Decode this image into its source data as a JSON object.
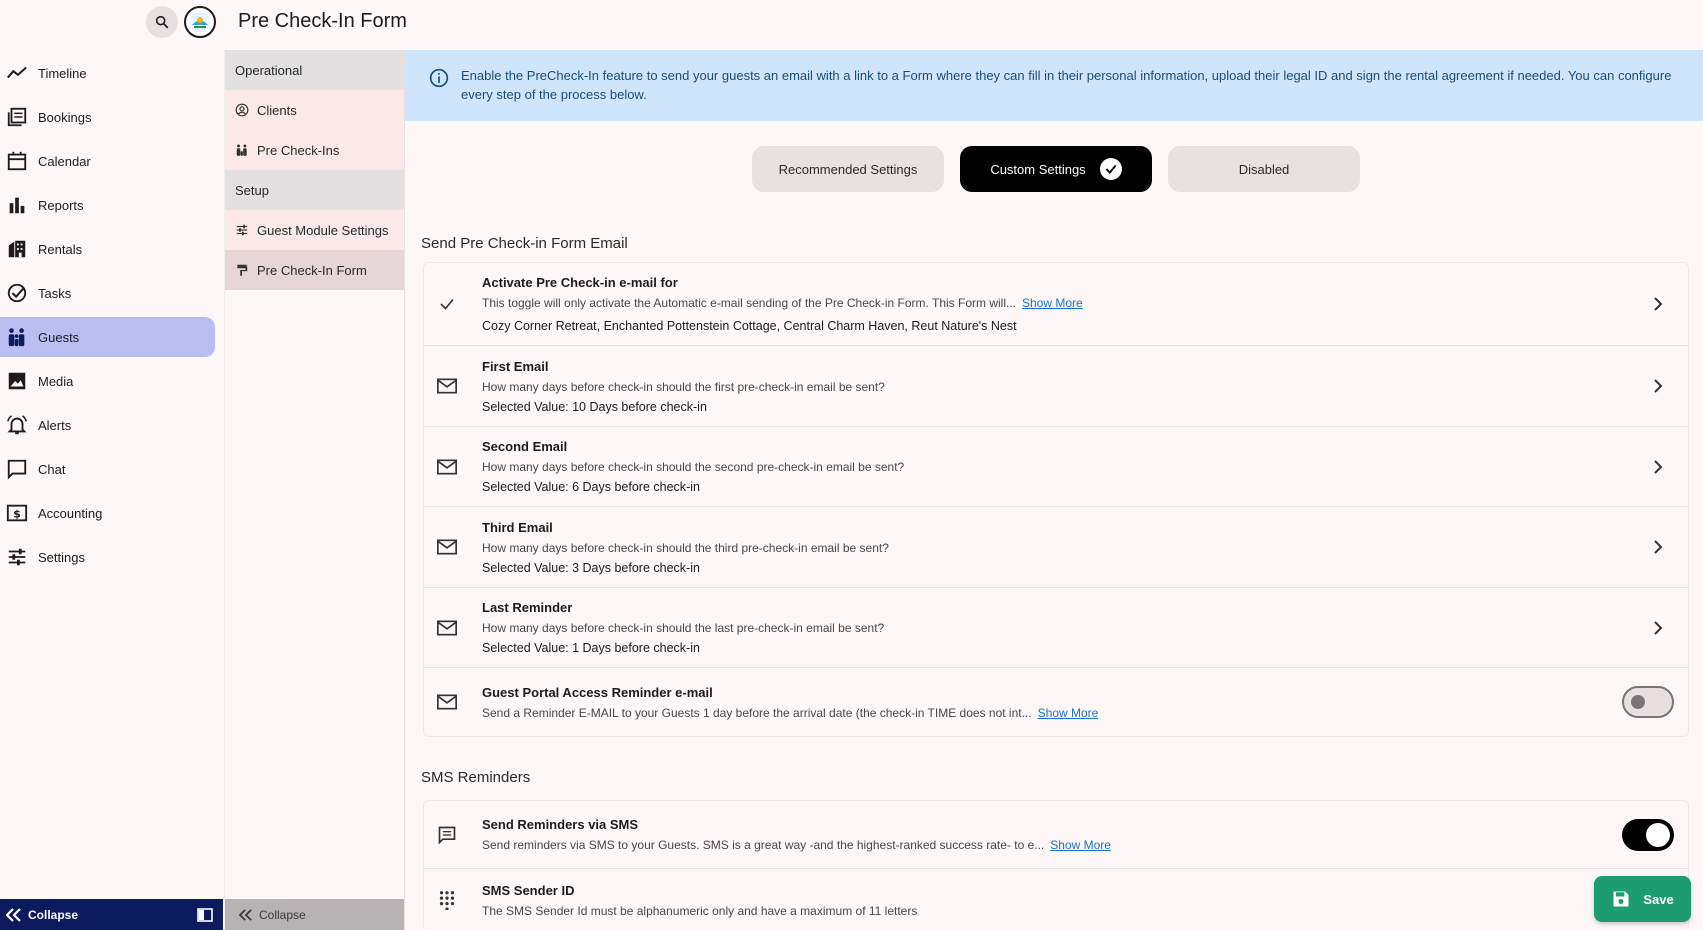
{
  "header": {
    "title": "Pre Check-In Form"
  },
  "nav": {
    "items": [
      {
        "label": "Timeline",
        "icon": "timeline-icon"
      },
      {
        "label": "Bookings",
        "icon": "bookings-icon"
      },
      {
        "label": "Calendar",
        "icon": "calendar-icon"
      },
      {
        "label": "Reports",
        "icon": "reports-icon"
      },
      {
        "label": "Rentals",
        "icon": "rentals-icon"
      },
      {
        "label": "Tasks",
        "icon": "tasks-icon"
      },
      {
        "label": "Guests",
        "icon": "guests-icon"
      },
      {
        "label": "Media",
        "icon": "media-icon"
      },
      {
        "label": "Alerts",
        "icon": "alerts-icon"
      },
      {
        "label": "Chat",
        "icon": "chat-icon"
      },
      {
        "label": "Accounting",
        "icon": "accounting-icon"
      },
      {
        "label": "Settings",
        "icon": "settings-icon"
      }
    ],
    "collapse_label": "Collapse"
  },
  "subnav": {
    "operational_header": "Operational",
    "clients": "Clients",
    "pre_check_ins": "Pre Check-Ins",
    "setup_header": "Setup",
    "guest_module_settings": "Guest Module Settings",
    "pre_check_in_form": "Pre Check-In Form",
    "collapse_label": "Collapse"
  },
  "info": {
    "text": "Enable the PreCheck-In feature to send your guests an email with a link to a Form where they can fill in their personal information, upload their legal ID and sign the rental agreement if needed. You can configure every step of the process below."
  },
  "modes": {
    "recommended": "Recommended Settings",
    "custom": "Custom Settings",
    "disabled": "Disabled"
  },
  "email_section": {
    "title": "Send Pre Check-in Form Email",
    "activate": {
      "title": "Activate Pre Check-in e-mail for",
      "desc": "This toggle will only activate the Automatic e-mail sending of the Pre Check-in Form. This Form will...",
      "show_more": "Show More",
      "value": "Cozy Corner Retreat, Enchanted Pottenstein Cottage, Central Charm Haven, Reut Nature's Nest"
    },
    "first": {
      "title": "First Email",
      "desc": "How many days before check-in should the first pre-check-in email be sent?",
      "value": "Selected Value: 10 Days before check-in"
    },
    "second": {
      "title": "Second Email",
      "desc": "How many days before check-in should the second pre-check-in email be sent?",
      "value": "Selected Value: 6 Days before check-in"
    },
    "third": {
      "title": "Third Email",
      "desc": "How many days before check-in should the third pre-check-in email be sent?",
      "value": "Selected Value: 3 Days before check-in"
    },
    "last": {
      "title": "Last Reminder",
      "desc": "How many days before check-in should the last pre-check-in email be sent?",
      "value": "Selected Value: 1 Days before check-in"
    },
    "portal": {
      "title": "Guest Portal Access Reminder e-mail",
      "desc": "Send a Reminder E-MAIL to your Guests 1 day before the arrival date (the check-in TIME does not int...",
      "show_more": "Show More"
    }
  },
  "sms_section": {
    "title": "SMS Reminders",
    "send": {
      "title": "Send Reminders via SMS",
      "desc": "Send reminders via SMS to your Guests. SMS is a great way -and the highest-ranked success rate- to e...",
      "show_more": "Show More"
    },
    "sender": {
      "title": "SMS Sender ID",
      "desc": "The SMS Sender Id must be alphanumeric only and have a maximum of 11 letters"
    }
  },
  "save_label": "Save"
}
